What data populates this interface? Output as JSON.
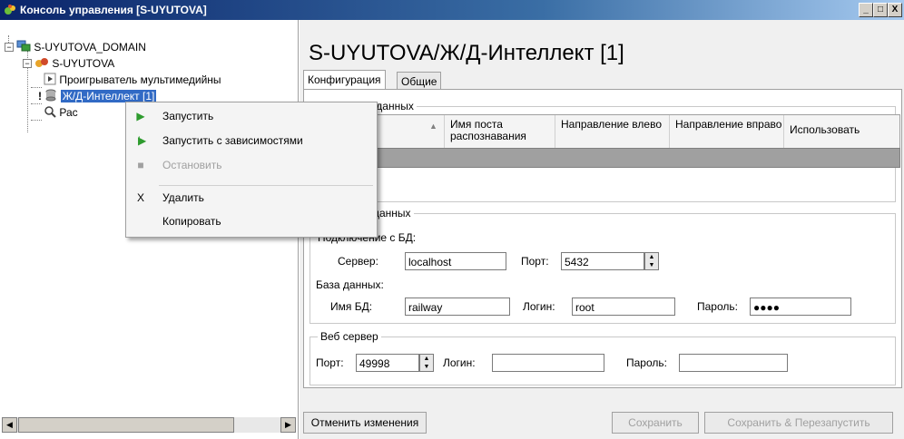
{
  "window": {
    "title": "Консоль управления [S-UYUTOVA]",
    "minimize": "_",
    "maximize": "□",
    "close": "X"
  },
  "tree": {
    "items": [
      {
        "label": "S-UYUTOVA_DOMAIN",
        "icon": "domain-icon"
      },
      {
        "label": "S-UYUTOVA",
        "icon": "server-icon"
      },
      {
        "label": "Проигрыватель мультимедийны",
        "icon": "player-icon"
      },
      {
        "label": "Ж/Д-Интеллект [1]",
        "icon": "database-icon"
      },
      {
        "label": "Рас",
        "icon": "magnifier-icon"
      }
    ]
  },
  "main": {
    "title": "S-UYUTOVA/Ж/Д-Интеллект [1]",
    "tabs": [
      "Конфигурация",
      "Общие"
    ],
    "sources_group": "Источники данных",
    "table": {
      "columns": [
        "",
        "Имя поста распознавания",
        "Направление влево",
        "Направление вправо",
        "Использовать"
      ]
    },
    "storage_group": "Хранение данных",
    "db_connection_label": "Подключение с БД:",
    "server_label": "Сервер:",
    "server_value": "localhost",
    "port_label": "Порт:",
    "port_value": "5432",
    "database_label": "База данных:",
    "dbname_label": "Имя БД:",
    "dbname_value": "railway",
    "login_label": "Логин:",
    "login_value": "root",
    "password_label": "Пароль:",
    "password_value": "●●●●",
    "web_group": "Веб сервер",
    "web_port_label": "Порт:",
    "web_port_value": "49998",
    "web_login_label": "Логин:",
    "web_login_value": "",
    "web_password_label": "Пароль:",
    "web_password_value": ""
  },
  "footer": {
    "cancel": "Отменить изменения",
    "save": "Сохранить",
    "save_restart": "Сохранить & Перезапустить"
  },
  "context_menu": {
    "start": "Запустить",
    "start_deps": "Запустить с зависимостями",
    "stop": "Остановить",
    "delete": "Удалить",
    "copy": "Копировать",
    "delete_icon_glyph": "X"
  },
  "colors": {
    "title_bar": "#0a246a",
    "selection": "#316ac5",
    "start_icon": "#2e9b2e"
  }
}
